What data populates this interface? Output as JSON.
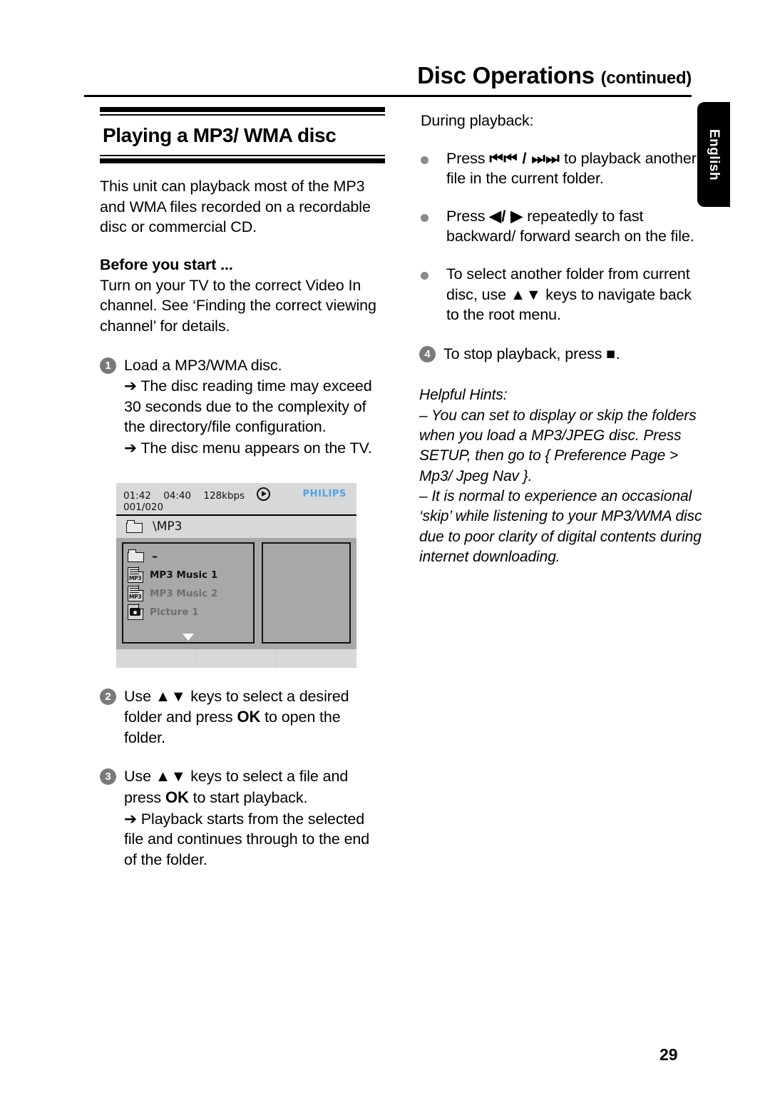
{
  "header": {
    "title": "Disc Operations",
    "continued": "(continued)"
  },
  "language_tab": {
    "label": "English"
  },
  "section": {
    "title": "Playing a MP3/ WMA disc",
    "intro": "This unit can playback most of the MP3 and WMA files recorded on a recordable disc or commercial CD.",
    "before_you_start_heading": "Before you start ...",
    "before_you_start_body": "Turn on your TV to the correct Video In channel. See ‘Finding the correct viewing channel’ for details."
  },
  "steps": [
    {
      "num": "1",
      "text": "Load a MP3/WMA disc.",
      "results": [
        "➔ The disc reading time may exceed 30 seconds due to the complexity of the directory/file configuration.",
        "➔ The disc menu appears on the TV."
      ]
    },
    {
      "num": "2",
      "text_before": "Use ",
      "keys": "▲▼",
      "text_mid": " keys to select a desired folder and press ",
      "ok": "OK",
      "text_after": " to open the folder.",
      "results": []
    },
    {
      "num": "3",
      "text_before": "Use ",
      "keys": "▲▼",
      "text_mid": " keys to select a file and press ",
      "ok": "OK",
      "text_after": " to start playback.",
      "results": [
        "➔ Playback starts from the selected file and continues through to the end of the folder."
      ]
    },
    {
      "num": "4",
      "text_before": "To stop playback, press ",
      "stop_glyph": "■",
      "text_after": "."
    }
  ],
  "right_column": {
    "lead": "During playback:",
    "bullets": [
      {
        "text_before": "Press ",
        "glyph": "⏮⏮ / ⏭⏭",
        "text_after": " to playback another file in the current folder."
      },
      {
        "text_before": "Press ",
        "glyph": "◀/ ▶",
        "text_after": " repeatedly to fast backward/ forward search on the file."
      },
      {
        "text_before": "To select another folder from current disc, use ",
        "glyph": "▲▼",
        "text_after": " keys to navigate back to the root menu."
      }
    ]
  },
  "hints": {
    "title": "Helpful Hints:",
    "items": [
      "–  You can set to display or skip the folders when you load a MP3/JPEG disc. Press SETUP, then go to { Preference Page > Mp3/ Jpeg Nav }.",
      "–  It is normal to experience an occasional ‘skip’ while listening to your MP3/WMA disc due to poor clarity of digital contents during internet downloading."
    ]
  },
  "tv_screen": {
    "elapsed_time": "01:42",
    "total_time": "04:40",
    "bitrate": "128kbps",
    "track_counter": "001/020",
    "brand": "PHILIPS",
    "path": "\\MP3",
    "items": [
      {
        "icon": "folder-icon",
        "label": "–",
        "selected": false
      },
      {
        "icon": "mp3-file-icon",
        "label": "MP3 Music 1",
        "selected": true
      },
      {
        "icon": "mp3-file-icon",
        "label": "MP3 Music 2",
        "selected": false
      },
      {
        "icon": "picture-file-icon",
        "label": "Picture 1",
        "selected": false
      }
    ]
  },
  "page_number": "29",
  "colors": {
    "brand_blue": "#4ea3e8",
    "screen_gray": "#a8a8a8",
    "screen_chrome": "#d8d8d8",
    "step_circle": "#7a7a7a"
  }
}
